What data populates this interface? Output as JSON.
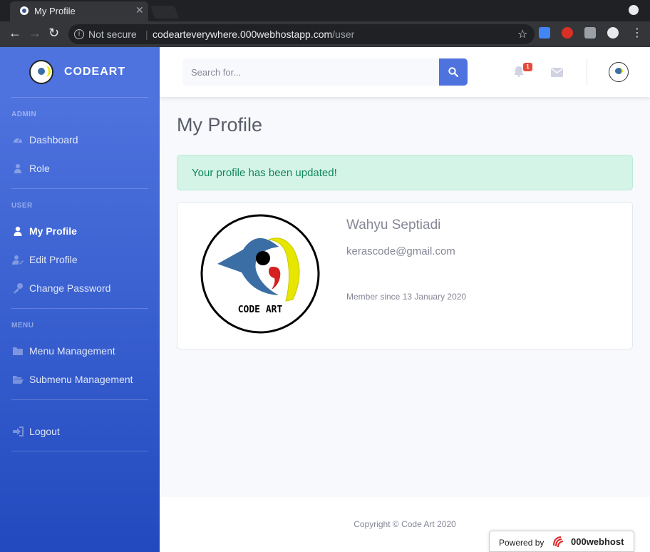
{
  "browser": {
    "tab_title": "My Profile",
    "tab_close": "✕",
    "not_secure": "Not secure",
    "url_host": "codearteverywhere.000webhostapp.com",
    "url_path": "/user"
  },
  "sidebar": {
    "brand": "CODEART",
    "sections": [
      {
        "heading": "ADMIN",
        "items": [
          {
            "label": "Dashboard",
            "icon": "tachometer-icon"
          },
          {
            "label": "Role",
            "icon": "user-tie-icon"
          }
        ]
      },
      {
        "heading": "USER",
        "items": [
          {
            "label": "My Profile",
            "icon": "user-icon",
            "active": true
          },
          {
            "label": "Edit Profile",
            "icon": "user-edit-icon"
          },
          {
            "label": "Change Password",
            "icon": "key-icon"
          }
        ]
      },
      {
        "heading": "MENU",
        "items": [
          {
            "label": "Menu Management",
            "icon": "folder-icon"
          },
          {
            "label": "Submenu Management",
            "icon": "folder-open-icon"
          }
        ]
      }
    ],
    "logout": "Logout"
  },
  "topbar": {
    "search_placeholder": "Search for...",
    "alert_count": "1"
  },
  "main": {
    "title": "My Profile",
    "alert": "Your profile has been updated!",
    "profile": {
      "logo_text": "CODE ART",
      "name": "Wahyu Septiadi",
      "email": "kerascode@gmail.com",
      "member_since": "Member since 13 January 2020"
    }
  },
  "footer": {
    "copyright": "Copyright © Code Art 2020",
    "powered_by": "Powered by",
    "host_brand": "000webhost"
  },
  "colors": {
    "primary": "#4e73df",
    "sidebar_bottom": "#224abe",
    "success_bg": "#d4f4e7",
    "success_text": "#13855c",
    "danger": "#e74a3b"
  }
}
